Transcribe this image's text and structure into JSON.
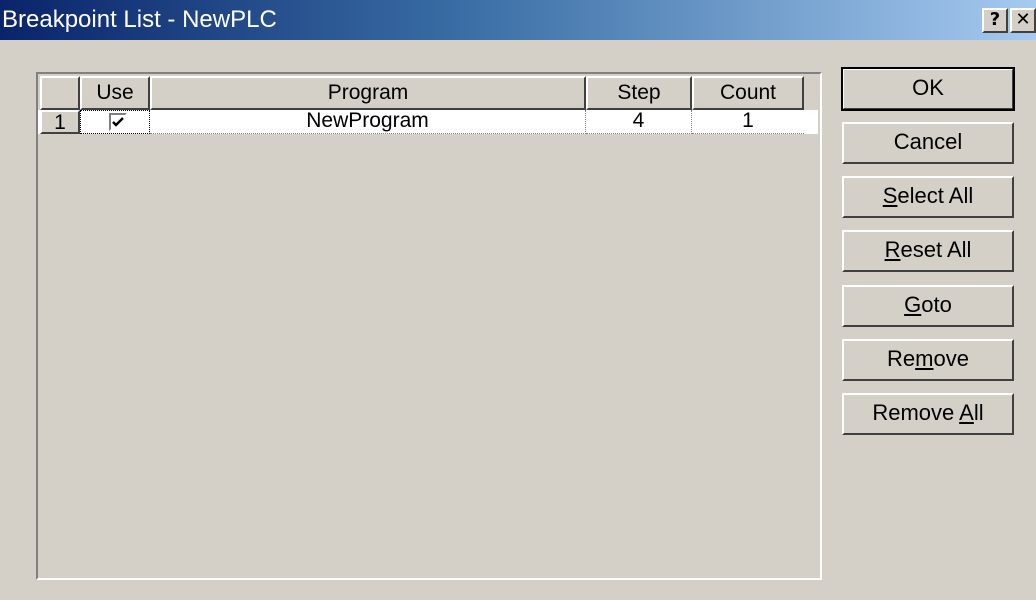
{
  "window": {
    "title": "Breakpoint List - NewPLC",
    "help_glyph": "?",
    "close_glyph": "✕"
  },
  "list": {
    "columns": [
      "",
      "Use",
      "Program",
      "Step",
      "Count"
    ],
    "rows": [
      {
        "num": "1",
        "use": true,
        "program": "NewProgram",
        "step": "4",
        "count": "1"
      }
    ]
  },
  "buttons": {
    "ok": "OK",
    "cancel": "Cancel",
    "select_all_mn": "S",
    "select_all_rest": "elect All",
    "reset_all_mn": "R",
    "reset_all_rest": "eset All",
    "goto_mn": "G",
    "goto_rest": "oto",
    "remove_pre": "Re",
    "remove_mn": "m",
    "remove_rest": "ove",
    "remove_all_pre": "Remove ",
    "remove_all_mn": "A",
    "remove_all_rest": "ll"
  },
  "colors": {
    "face": "#d4d0c8",
    "title_start": "#0a246a",
    "title_end": "#a6caf0"
  }
}
